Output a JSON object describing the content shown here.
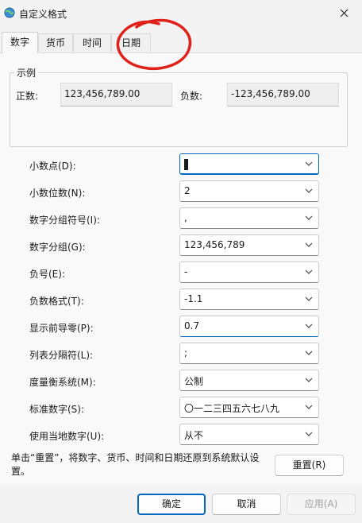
{
  "window": {
    "title": "自定义格式"
  },
  "tabs": [
    {
      "label": "数字"
    },
    {
      "label": "货币"
    },
    {
      "label": "时间"
    },
    {
      "label": "日期"
    }
  ],
  "example": {
    "legend": "示例",
    "positive_label": "正数:",
    "positive_value": "123,456,789.00",
    "negative_label": "负数:",
    "negative_value": "-123,456,789.00"
  },
  "settings": [
    {
      "label": "小数点(D):",
      "value": "."
    },
    {
      "label": "小数位数(N):",
      "value": "2"
    },
    {
      "label": "数字分组符号(I):",
      "value": ","
    },
    {
      "label": "数字分组(G):",
      "value": "123,456,789"
    },
    {
      "label": "负号(E):",
      "value": "-"
    },
    {
      "label": "负数格式(T):",
      "value": "-1.1"
    },
    {
      "label": "显示前导零(P):",
      "value": "0.7"
    },
    {
      "label": "列表分隔符(L):",
      "value": ";"
    },
    {
      "label": "度量衡系统(M):",
      "value": "公制"
    },
    {
      "label": "标准数字(S):",
      "value": "〇一二三四五六七八九"
    },
    {
      "label": "使用当地数字(U):",
      "value": "从不"
    }
  ],
  "footer": {
    "note": "单击“重置”，将数字、货币、时间和日期还原到系统默认设置。",
    "reset": "重置(R)",
    "ok": "确定",
    "cancel": "取消",
    "apply": "应用(A)"
  },
  "colors": {
    "accent": "#0067c0",
    "annotation": "#e0211a"
  }
}
